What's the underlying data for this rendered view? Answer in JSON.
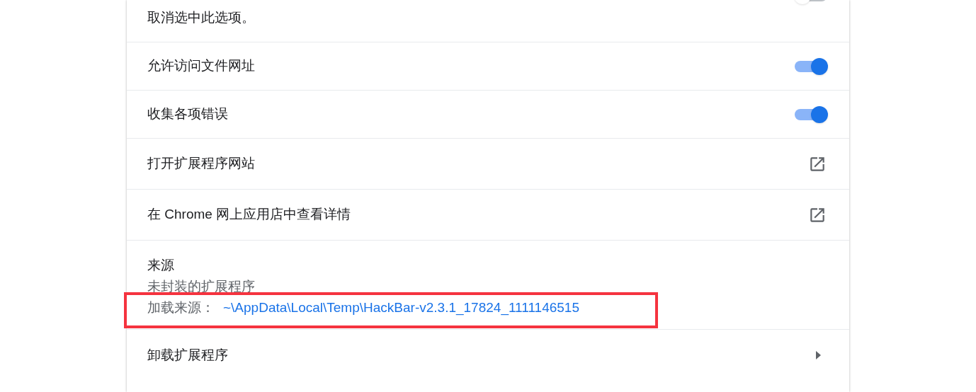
{
  "rows": [
    {
      "kind": "toggle",
      "label": "取消选中此选项。",
      "on": false,
      "cut": true
    },
    {
      "kind": "toggle",
      "label": "允许访问文件网址",
      "on": true
    },
    {
      "kind": "toggle",
      "label": "收集各项错误",
      "on": true
    },
    {
      "kind": "link",
      "label": "打开扩展程序网站"
    },
    {
      "kind": "link",
      "label": "在 Chrome 网上应用店中查看详情"
    },
    {
      "kind": "source",
      "title": "来源",
      "subtitle": "未封装的扩展程序",
      "load_label": "加载来源：",
      "load_path": "~\\AppData\\Local\\Temp\\HackBar-v2.3.1_17824_1111146515",
      "highlighted": true
    },
    {
      "kind": "submenu",
      "label": "卸载扩展程序"
    }
  ]
}
